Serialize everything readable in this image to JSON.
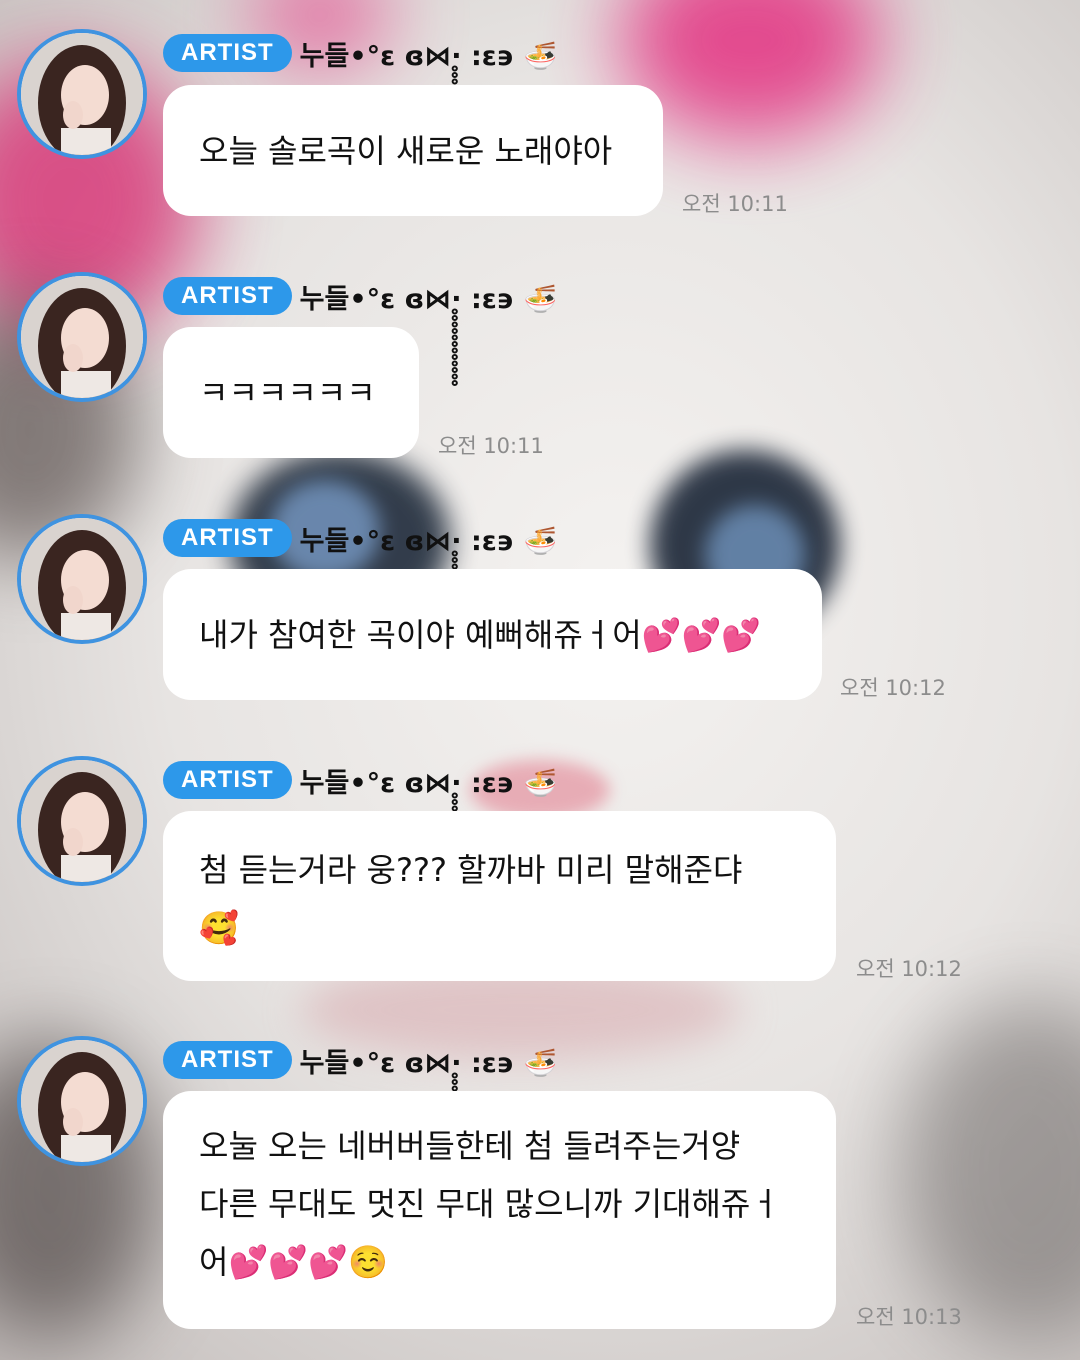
{
  "badge": "ARTIST",
  "username": "누들•°ε ɞ⋈·̥̥̥̥̥̥̥̥̥̥̥̥ :ε϶ 🍜",
  "messages": [
    {
      "text": "오늘 솔로곡이 새로운 노래야아",
      "time": "오전 10:11"
    },
    {
      "text": "ㅋㅋㅋㅋㅋㅋ",
      "time": "오전 10:11"
    },
    {
      "text": "내가 참여한 곡이야 예뻐해쥬ㅓ어💕💕💕",
      "time": "오전 10:12"
    },
    {
      "text": "첨 듣는거라 웅??? 할까바 미리 말해준댜\n🥰",
      "time": "오전 10:12"
    },
    {
      "text": "오눌 오는 네버버들한테 첨 들려주는거양\n다른 무대도 멋진 무대 많으니까 기대해쥬ㅓ\n어💕💕💕☺️",
      "time": "오전 10:13"
    }
  ]
}
